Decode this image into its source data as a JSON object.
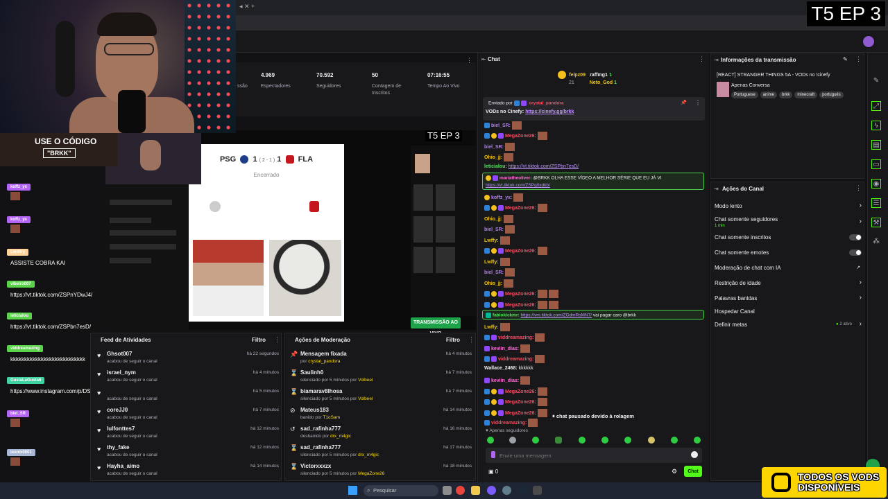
{
  "browser": {
    "tab_controls": "◂ ✕  +"
  },
  "episode_badge": "T5 EP 3",
  "episode_badge_small": "T5 EP 3",
  "promo": {
    "line1": "USE O CÓDIGO",
    "code": "\"BRKK\""
  },
  "overlay_chat": [
    {
      "name": "koffz_yx",
      "color": "#b565f5",
      "text": ""
    },
    {
      "name": "koffz_yx",
      "color": "#b565f5",
      "text": ""
    },
    {
      "name": "Lwd4ry",
      "color": "#ffd39a",
      "text": "ASSISTE COBRA KAI"
    },
    {
      "name": "vibeiro007",
      "color": "#5ad34b",
      "text": "https://vt.tiktok.com/ZSPnYDwJ4/"
    },
    {
      "name": "leticialou",
      "color": "#5ad34b",
      "text": "https://vt.tiktok.com/ZSPbn7esD/"
    },
    {
      "name": "viddreamazing",
      "color": "#5ad34b",
      "text": "kkkkkkkkkkkkkkkkkkkkkkkkkkk"
    },
    {
      "name": "GustaLaGusta6",
      "color": "#3ed3a0",
      "text": "https://www.instagram.com/p/DSkGZULkb4e/"
    },
    {
      "name": "biel_SR",
      "color": "#b565f5",
      "text": ""
    },
    {
      "name": "leonix0001",
      "color": "#a8b7d6",
      "text": ""
    }
  ],
  "stats": [
    {
      "value": "",
      "label": "ssão"
    },
    {
      "value": "4.969",
      "label": "Espectadores"
    },
    {
      "value": "70.592",
      "label": "Seguidores"
    },
    {
      "value": "50",
      "label": "Contagem de Inscritos"
    },
    {
      "value": "07:16:55",
      "label": "Tempo Ao Vivo"
    }
  ],
  "preview": {
    "home": "PSG",
    "home_score": "1",
    "penalties": "( 2 - 1 )",
    "away_score": "1",
    "away": "FLA",
    "status": "Encerrado",
    "live_button": "TRANSMISSÃO AO VIVO"
  },
  "activity_feed": {
    "title": "Feed de Atividades",
    "filter": "Filtro",
    "items": [
      {
        "user": "Ghsot007",
        "action": "acabou de seguir o canal",
        "time": "há 22 segundos"
      },
      {
        "user": "israel_nym",
        "action": "acabou de seguir o canal",
        "time": "há 4 minutos"
      },
      {
        "user": "",
        "action": "acabou de seguir o canal",
        "time": "há 5 minutos"
      },
      {
        "user": "coreJJ0",
        "action": "acabou de seguir o canal",
        "time": "há 7 minutos"
      },
      {
        "user": "lulfonttes7",
        "action": "acabou de seguir o canal",
        "time": "há 12 minutos"
      },
      {
        "user": "thy_fake",
        "action": "acabou de seguir o canal",
        "time": "há 12 minutos"
      },
      {
        "user": "Hayha_aimo",
        "action": "acabou de seguir o canal",
        "time": "há 14 minutos"
      }
    ]
  },
  "mod_actions": {
    "title": "Ações de Moderação",
    "filter": "Filtro",
    "items": [
      {
        "icon": "pin-icon",
        "glyph": "📌",
        "title": "Mensagem fixada",
        "sub": "por ",
        "by": "crystal_pandora",
        "time": "há 4 minutos"
      },
      {
        "icon": "hourglass-icon",
        "glyph": "⌛",
        "title": "Saulinh0",
        "sub": "silenciado por 5 minutos por ",
        "by": "Volbeel",
        "time": "há 7 minutos"
      },
      {
        "icon": "hourglass-icon",
        "glyph": "⌛",
        "title": "biamarav8lhosa",
        "sub": "silenciado por 5 minutos por ",
        "by": "Volbeel",
        "time": "há 7 minutos"
      },
      {
        "icon": "ban-icon",
        "glyph": "⊘",
        "title": "Mateus183",
        "sub": "banido por ",
        "by": "T1oSam",
        "time": "há 14 minutos"
      },
      {
        "icon": "undo-icon",
        "glyph": "↺",
        "title": "sad_rafinha777",
        "sub": "desbanido por ",
        "by": "drx_m4gic",
        "time": "há 16 minutos"
      },
      {
        "icon": "hourglass-icon",
        "glyph": "⌛",
        "title": "sad_rafinha777",
        "sub": "silenciado por 5 minutos por ",
        "by": "drx_m4gic",
        "time": "há 17 minutos"
      },
      {
        "icon": "hourglass-icon",
        "glyph": "⌛",
        "title": "Victorxxxzx",
        "sub": "silenciado por 5 minutos por ",
        "by": "MegaZone26",
        "time": "há 18 minutos"
      }
    ]
  },
  "chat": {
    "title": "Chat",
    "top_gifters": [
      {
        "name": "felpz09",
        "count": "21"
      },
      {
        "name": "raffmg1",
        "count": "1"
      },
      {
        "name": "Neto_God",
        "count": "1"
      }
    ],
    "pinned": {
      "label": "Enviado por",
      "by": "crystal_pandora",
      "text": "VODs no Cinefy: ",
      "link": "https://cinefy.gg/brkk"
    },
    "messages": [
      {
        "user": "biel_SR:",
        "cls": "n-pur",
        "text": "",
        "emote": true
      },
      {
        "user": "MegaZone26:",
        "cls": "n-red",
        "text": "",
        "emote": true
      },
      {
        "user": "biel_SR:",
        "cls": "n-pur",
        "text": "",
        "emote": true
      },
      {
        "user": "Ohio_jj:",
        "cls": "n-yel",
        "text": "",
        "emote": true
      },
      {
        "user": "leticialou:",
        "cls": "n-grn",
        "text": "",
        "link": "https://vt.tiktok.com/ZSPbn7esD/"
      },
      {
        "user": "",
        "cls": "n-pnk",
        "text": "",
        "emote": false
      },
      {
        "user": "koffz_yx:",
        "cls": "n-pur",
        "text": "",
        "emote": true
      },
      {
        "user": "MegaZone26:",
        "cls": "n-red",
        "text": "",
        "emote": true
      },
      {
        "user": "Ohio_jj:",
        "cls": "n-yel",
        "text": "",
        "emote": true
      },
      {
        "user": "biel_SR:",
        "cls": "n-pur",
        "text": "",
        "emote": true
      },
      {
        "user": "Lwffy:",
        "cls": "n-yel",
        "text": "",
        "emote": true
      },
      {
        "user": "MegaZone26:",
        "cls": "n-red",
        "text": "",
        "emote": true
      },
      {
        "user": "Lwffy:",
        "cls": "n-yel",
        "text": "",
        "emote": true
      },
      {
        "user": "biel_SR:",
        "cls": "n-pur",
        "text": "",
        "emote": true
      },
      {
        "user": "Ohio_jj:",
        "cls": "n-yel",
        "text": "",
        "emote": true
      },
      {
        "user": "MegaZone26:",
        "cls": "n-red",
        "text": "",
        "emote": true
      },
      {
        "user": "MegaZone26:",
        "cls": "n-red",
        "text": "",
        "emote": true
      }
    ],
    "highlight1": {
      "user": "mariatheoliver:",
      "text": "@BRKK OLHA ESSE VÍDEO A MELHOR SÉRIE QUE EU JÁ VI",
      "link": "https://vt.tiktok.com/ZSPg0xdkb/"
    },
    "highlight2": {
      "user": "fabiokickmr:",
      "link": "https://vm.tiktok.com/ZGdmRsMN7/",
      "text": " vai pagar caro @brkk"
    },
    "after": [
      {
        "user": "Lwffy:",
        "cls": "n-yel",
        "text": ""
      },
      {
        "user": "viddreamazing:",
        "cls": "n-red",
        "text": ""
      },
      {
        "user": "keviin_dias:",
        "cls": "n-pnk",
        "text": ""
      },
      {
        "user": "viddreamazing:",
        "cls": "n-red",
        "text": ""
      },
      {
        "user": "Wallace_2468:",
        "cls": "n-wht",
        "text": "kkkkkk"
      },
      {
        "user": "keviin_dias:",
        "cls": "n-pnk",
        "text": ""
      },
      {
        "user": "MegaZone26:",
        "cls": "n-red",
        "text": ""
      },
      {
        "user": "MegaZone26:",
        "cls": "n-red",
        "text": ""
      },
      {
        "user": "MegaZone26:",
        "cls": "n-red",
        "text": ""
      },
      {
        "user": "viddreamazing:",
        "cls": "n-red",
        "text": ""
      }
    ],
    "paused": "chat pausado devido à rolagem",
    "followers_only": "Apenas seguidores",
    "placeholder": "Envie uma mensagem",
    "points": "0",
    "send": "Chat"
  },
  "stream_info": {
    "title": "Informações da transmissão",
    "stream_title": "[REACT] STRANGER THINGS 5A - VODs no !cinefy",
    "category": "Apenas Conversa",
    "tags": [
      "Portuguese",
      "anime",
      "brkk",
      "minecraft",
      "português"
    ]
  },
  "channel_actions": {
    "title": "Ações do Canal",
    "items": [
      {
        "label": "Modo lento",
        "sub": "",
        "control": "chevron"
      },
      {
        "label": "Chat somente seguidores",
        "sub": "1 min",
        "control": "chevron"
      },
      {
        "label": "Chat somente inscritos",
        "sub": "",
        "control": "toggle"
      },
      {
        "label": "Chat somente emotes",
        "sub": "",
        "control": "toggle"
      },
      {
        "label": "Moderação de chat com IA",
        "sub": "",
        "control": "external"
      },
      {
        "label": "Restrição de idade",
        "sub": "",
        "control": "chevron"
      },
      {
        "label": "Palavras banidas",
        "sub": "",
        "control": "chevron"
      },
      {
        "label": "Hospedar Canal",
        "sub": "",
        "control": "none"
      },
      {
        "label": "Definir metas",
        "sub": "",
        "control": "status",
        "status": "2 ativo"
      }
    ]
  },
  "taskbar": {
    "search": "Pesquisar"
  },
  "vods_banner": {
    "line1": "TODOS OS VODS",
    "line2": "DISPONÍVEIS"
  },
  "colors": {
    "accent": "#53fc18",
    "chat_bg": "#18181b",
    "link": "#bf94ff",
    "banner": "#ffd500"
  }
}
